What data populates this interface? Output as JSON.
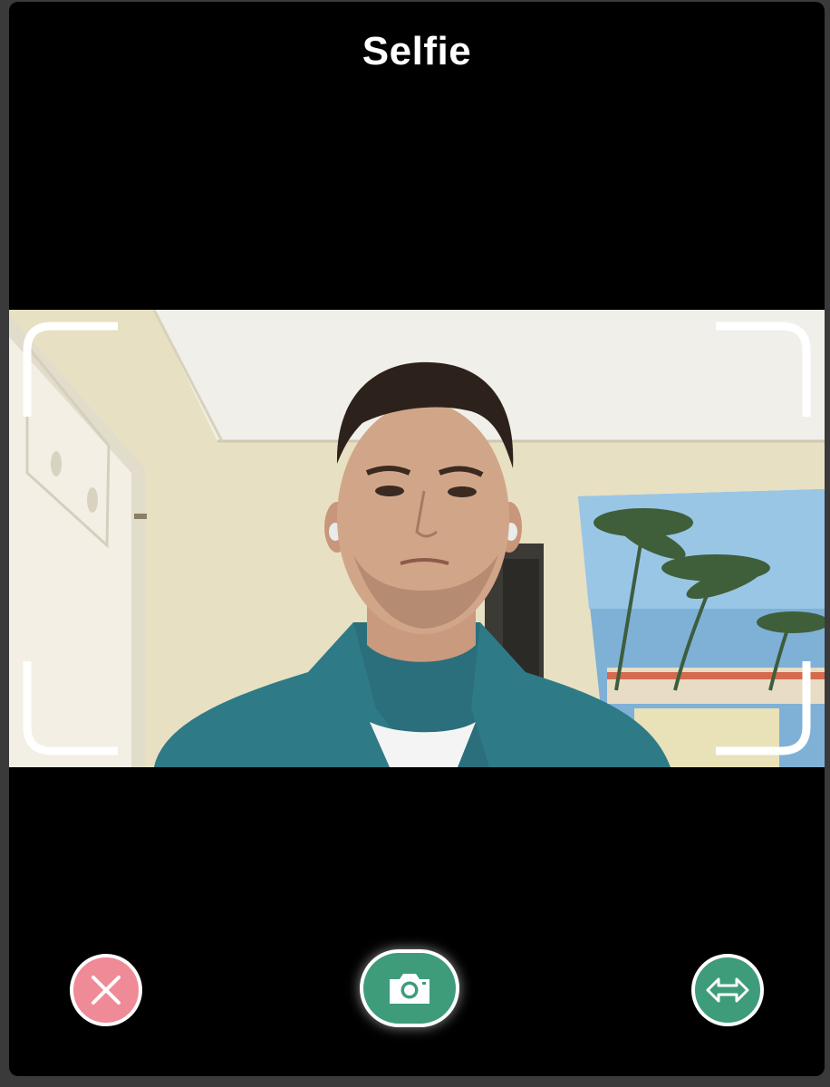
{
  "header": {
    "title": "Selfie"
  },
  "camera": {
    "preview": "live-camera-preview",
    "frame_guide": "viewfinder-corners"
  },
  "controls": {
    "cancel": {
      "icon": "close-icon",
      "color": "#ef8a97"
    },
    "capture": {
      "icon": "camera-icon",
      "color": "#3e9c7a"
    },
    "flip": {
      "icon": "flip-horizontal-icon",
      "color": "#3e9c7a"
    }
  }
}
